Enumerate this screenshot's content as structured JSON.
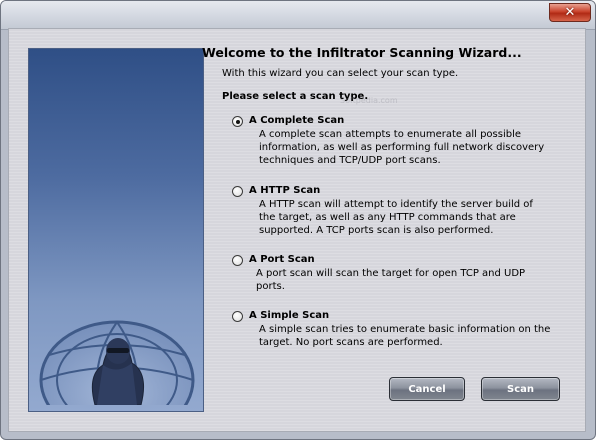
{
  "window": {
    "close_glyph": "✕"
  },
  "wizard": {
    "title": "Welcome to the Infiltrator Scanning Wizard...",
    "intro": "With this wizard you can select your scan type.",
    "select_label": "Please select a scan type.",
    "watermark": "Softpedia.com"
  },
  "options": [
    {
      "title": "A Complete Scan",
      "description": "A complete scan attempts to enumerate all possible information, as well as performing full network discovery techniques and TCP/UDP port scans.",
      "selected": true
    },
    {
      "title": "A HTTP Scan",
      "description": "A HTTP scan will attempt to identify the server build of the target, as well as any HTTP commands that are supported. A TCP ports scan is also performed.",
      "selected": false
    },
    {
      "title": "A Port Scan",
      "description": "A port scan will scan the target for open TCP and UDP ports.",
      "selected": false
    },
    {
      "title": "A Simple Scan",
      "description": "A simple scan tries to enumerate basic information on the target. No port scans are performed.",
      "selected": false
    }
  ],
  "buttons": {
    "cancel": "Cancel",
    "scan": "Scan"
  },
  "colors": {
    "side_panel_top": "#2f4f86",
    "side_panel_bottom": "#93a9cf",
    "button_face": "#80868f",
    "close_button": "#c9432c"
  },
  "icons": {
    "logo": "globe-figure-logo-icon",
    "close": "close-icon"
  }
}
